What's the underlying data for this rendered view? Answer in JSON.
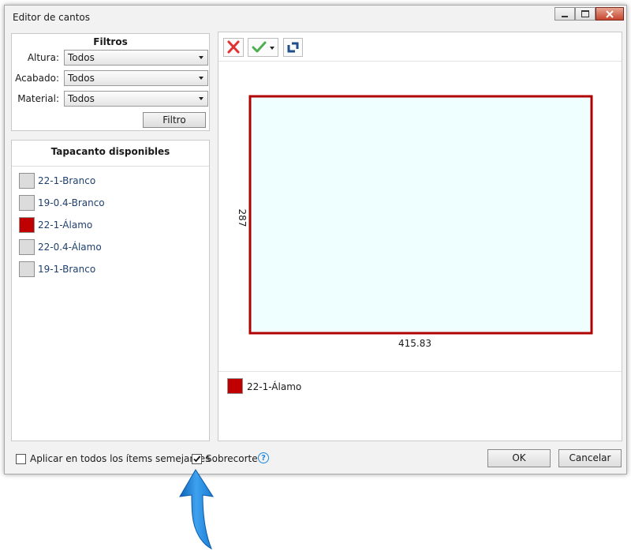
{
  "window": {
    "title": "Editor de cantos"
  },
  "filters": {
    "title": "Filtros",
    "altura_label": "Altura:",
    "altura_value": "Todos",
    "acabado_label": "Acabado:",
    "acabado_value": "Todos",
    "material_label": "Material:",
    "material_value": "Todos",
    "filter_button": "Filtro"
  },
  "edge_list": {
    "title": "Tapacanto disponibles",
    "items": [
      {
        "label": "22-1-Branco",
        "color": "#dcdcdc"
      },
      {
        "label": "19-0.4-Branco",
        "color": "#dcdcdc"
      },
      {
        "label": "22-1-Álamo",
        "color": "#c00000"
      },
      {
        "label": "22-0.4-Álamo",
        "color": "#dcdcdc"
      },
      {
        "label": "19-1-Branco",
        "color": "#dcdcdc"
      }
    ]
  },
  "preview": {
    "height_dim": "287",
    "width_dim": "415.83",
    "fill_color": "#effefe",
    "edge_color": "#b00000",
    "selected_edge_label": "22-1-Álamo",
    "selected_edge_color": "#c00000"
  },
  "footer": {
    "apply_all_label": "Aplicar en todos los ítems semejantes",
    "apply_all_checked": false,
    "overcut_label": "Sobrecorte",
    "overcut_checked": true,
    "ok_button": "OK",
    "cancel_button": "Cancelar"
  },
  "icons": {
    "delete": "red-x-icon",
    "confirm": "green-check-icon",
    "rotate": "rotate-icon",
    "help": "help-icon",
    "arrow": "blue-up-arrow-icon"
  },
  "colors": {
    "accent_blue": "#1e88e5",
    "delete_red": "#e03030",
    "confirm_green": "#4caf50"
  }
}
